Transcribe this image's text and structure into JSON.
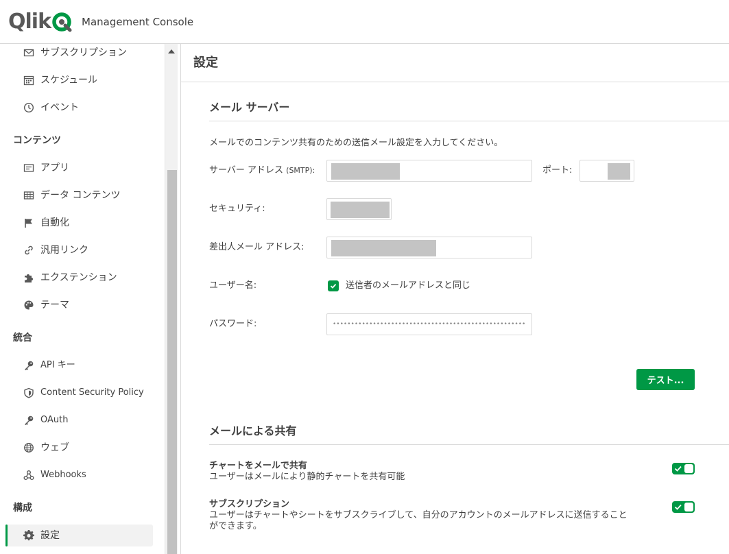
{
  "header": {
    "logo_text": "Qlik",
    "app_name": "Management Console"
  },
  "sidebar": {
    "items_top": [
      {
        "label": "サブスクリプション",
        "icon": "envelope-icon"
      },
      {
        "label": "スケジュール",
        "icon": "calendar-icon"
      },
      {
        "label": "イベント",
        "icon": "clock-icon"
      }
    ],
    "section_content": "コンテンツ",
    "items_content": [
      {
        "label": "アプリ",
        "icon": "app-icon"
      },
      {
        "label": "データ コンテンツ",
        "icon": "table-icon"
      },
      {
        "label": "自動化",
        "icon": "flag-icon"
      },
      {
        "label": "汎用リンク",
        "icon": "link-icon"
      },
      {
        "label": "エクステンション",
        "icon": "puzzle-icon"
      },
      {
        "label": "テーマ",
        "icon": "palette-icon"
      }
    ],
    "section_integration": "統合",
    "items_integration": [
      {
        "label": "API キー",
        "icon": "key-icon"
      },
      {
        "label": "Content Security Policy",
        "icon": "shield-icon"
      },
      {
        "label": "OAuth",
        "icon": "key-icon"
      },
      {
        "label": "ウェブ",
        "icon": "globe-icon"
      },
      {
        "label": "Webhooks",
        "icon": "webhooks-icon"
      }
    ],
    "section_config": "構成",
    "items_config": [
      {
        "label": "設定",
        "icon": "gear-icon",
        "active": true
      }
    ]
  },
  "main": {
    "page_title": "設定",
    "mail_server": {
      "title": "メール サーバー",
      "description": "メールでのコンテンツ共有のための送信メール設定を入力してください。",
      "server_address_label": "サーバー アドレス",
      "server_address_suffix": "(SMTP):",
      "port_label": "ポート:",
      "security_label": "セキュリティ:",
      "sender_label": "差出人メール アドレス:",
      "username_label": "ユーザー名:",
      "username_checkbox_label": "送信者のメールアドレスと同じ",
      "password_label": "パスワード:",
      "password_value": "••••••••••••••••••••••••••••••••••••••••••••••••••••••••••••••••••",
      "test_button": "テスト..."
    },
    "email_sharing": {
      "title": "メールによる共有",
      "items": [
        {
          "title": "チャートをメールで共有",
          "description": "ユーザーはメールにより静的チャートを共有可能",
          "enabled": true
        },
        {
          "title": "サブスクリプション",
          "description": "ユーザーはチャートやシートをサブスクライブして、自分のアカウントのメールアドレスに送信することができます。",
          "enabled": true
        }
      ]
    }
  },
  "colors": {
    "accent": "#009845",
    "text": "#404040",
    "border": "#d9d9d9"
  }
}
